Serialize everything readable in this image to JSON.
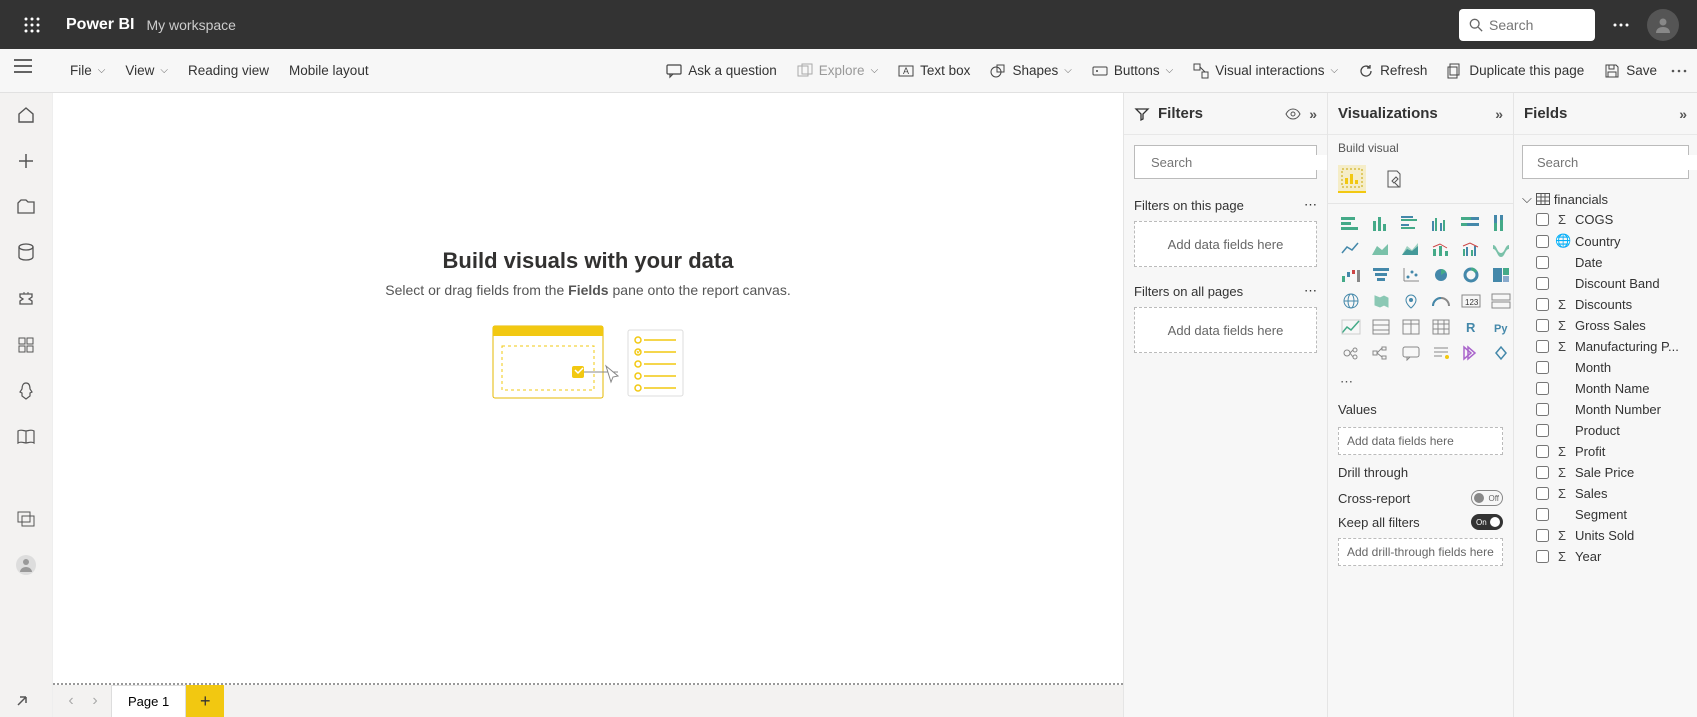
{
  "app": {
    "brand": "Power BI",
    "workspace": "My workspace"
  },
  "topSearch": {
    "placeholder": "Search"
  },
  "ribbon": {
    "file": "File",
    "view": "View",
    "readingView": "Reading view",
    "mobileLayout": "Mobile layout",
    "askQuestion": "Ask a question",
    "explore": "Explore",
    "textBox": "Text box",
    "shapes": "Shapes",
    "buttons": "Buttons",
    "visualInteractions": "Visual interactions",
    "refresh": "Refresh",
    "duplicate": "Duplicate this page",
    "save": "Save"
  },
  "canvas": {
    "title": "Build visuals with your data",
    "subtitle_pre": "Select or drag fields from the ",
    "subtitle_bold": "Fields",
    "subtitle_post": " pane onto the report canvas."
  },
  "tabs": {
    "page1": "Page 1"
  },
  "filters": {
    "title": "Filters",
    "search": "Search",
    "onThisPage": "Filters on this page",
    "addHere": "Add data fields here",
    "onAllPages": "Filters on all pages"
  },
  "viz": {
    "title": "Visualizations",
    "buildVisual": "Build visual",
    "values": "Values",
    "addHere": "Add data fields here",
    "drillThrough": "Drill through",
    "crossReport": "Cross-report",
    "keepAllFilters": "Keep all filters",
    "addDrill": "Add drill-through fields here",
    "off": "Off",
    "on": "On"
  },
  "fields": {
    "title": "Fields",
    "search": "Search",
    "table": "financials",
    "items": [
      {
        "name": "COGS",
        "icon": "sigma"
      },
      {
        "name": "Country",
        "icon": "globe"
      },
      {
        "name": "Date",
        "icon": "none"
      },
      {
        "name": "Discount Band",
        "icon": "none"
      },
      {
        "name": "Discounts",
        "icon": "sigma"
      },
      {
        "name": "Gross Sales",
        "icon": "sigma"
      },
      {
        "name": "Manufacturing P...",
        "icon": "sigma"
      },
      {
        "name": "Month",
        "icon": "none"
      },
      {
        "name": "Month Name",
        "icon": "none"
      },
      {
        "name": "Month Number",
        "icon": "none"
      },
      {
        "name": "Product",
        "icon": "none"
      },
      {
        "name": "Profit",
        "icon": "sigma"
      },
      {
        "name": "Sale Price",
        "icon": "sigma"
      },
      {
        "name": "Sales",
        "icon": "sigma"
      },
      {
        "name": "Segment",
        "icon": "none"
      },
      {
        "name": "Units Sold",
        "icon": "sigma"
      },
      {
        "name": "Year",
        "icon": "sigma"
      }
    ]
  }
}
